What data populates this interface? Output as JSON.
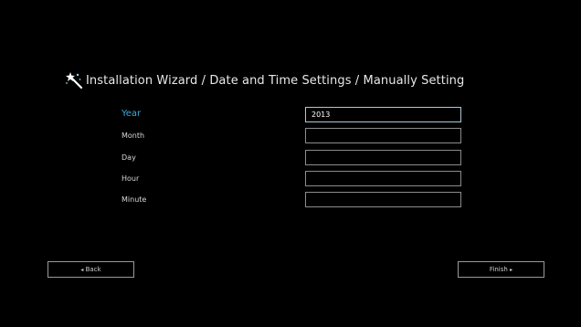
{
  "wizard": {
    "title": "Installation Wizard / Date and Time Settings / Manually Setting"
  },
  "fields": [
    {
      "label": "Year",
      "value": "2013",
      "active": true
    },
    {
      "label": "Month",
      "value": "",
      "active": false
    },
    {
      "label": "Day",
      "value": "",
      "active": false
    },
    {
      "label": "Hour",
      "value": "",
      "active": false
    },
    {
      "label": "Minute",
      "value": "",
      "active": false
    }
  ],
  "buttons": {
    "back_arrow": "◂",
    "back_label": "Back",
    "finish_label": "Finish",
    "finish_arrow": "▸"
  },
  "colors": {
    "background": "#000000",
    "accent": "#3aa9dc",
    "text": "#e6e6e6",
    "border": "#8c8c8c"
  },
  "icons": {
    "header": "magic-wand-icon"
  }
}
